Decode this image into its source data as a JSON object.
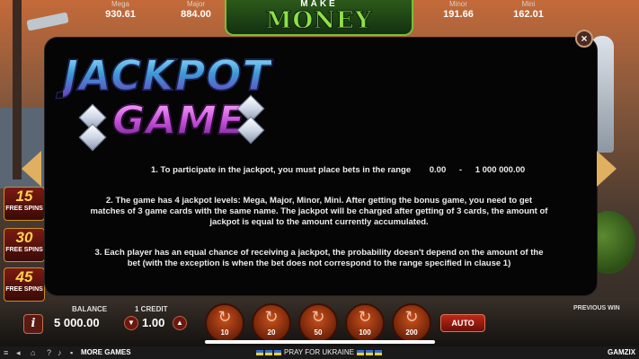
{
  "jackpots": {
    "mega": {
      "label": "Mega",
      "value": "930.61"
    },
    "major": {
      "label": "Major",
      "value": "884.00"
    },
    "minor": {
      "label": "Minor",
      "value": "191.66"
    },
    "mini": {
      "label": "Mini",
      "value": "162.01"
    }
  },
  "logo": {
    "line1": "MAKE",
    "line2": "MONEY"
  },
  "modal": {
    "title_line1": "JACKPOT",
    "title_line2": "GAME",
    "close_label": "×",
    "rule1_text": "1. To participate in the jackpot, you must place bets in the range",
    "rule1_min": "0.00",
    "rule1_dash": "-",
    "rule1_max": "1 000 000.00",
    "rule2_text": "2. The game has 4 jackpot levels: Mega, Major, Minor, Mini. After getting  the bonus game, you need to get matches of 3 game cards with the same name. The jackpot will be charged after getting of 3 cards, the amount of jackpot is equal to the amount currently accumulated.",
    "rule3_text": "3. Each player has an equal chance of receiving a jackpot, the probability doesn't depend on the amount of the bet (with the exception is when the bet does not correspond to the range specified in clause 1)"
  },
  "free_spins": [
    {
      "number": "15",
      "label": "FREE SPINS"
    },
    {
      "number": "30",
      "label": "FREE SPINS"
    },
    {
      "number": "45",
      "label": "FREE SPINS"
    }
  ],
  "controls": {
    "info_label": "i",
    "balance_label": "BALANCE",
    "balance_value": "5 000.00",
    "credit_label": "1 CREDIT",
    "credit_value": "1.00",
    "bets": [
      "10",
      "20",
      "50",
      "100",
      "200"
    ],
    "auto_label": "AUTO",
    "previous_win_label": "PREVIOUS WIN"
  },
  "footer": {
    "more_games": "MORE GAMES",
    "pray": "PRAY FOR UKRAINE",
    "brand": "GAMZIX"
  },
  "colors": {
    "modal_bg": "#050505",
    "accent_orange": "#c8501c",
    "logo_green": "#8fe04a"
  }
}
